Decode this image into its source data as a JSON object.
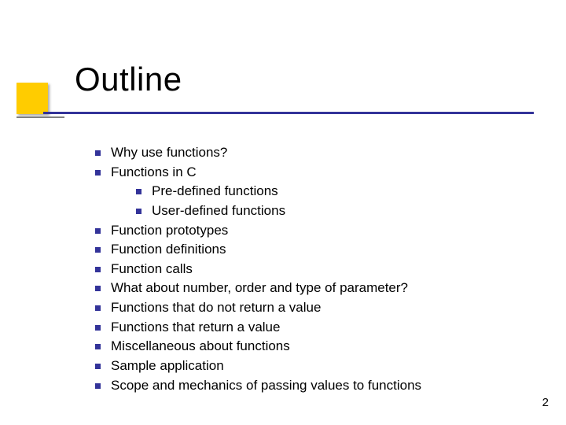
{
  "title": "Outline",
  "bullets": [
    {
      "text": "Why use functions?"
    },
    {
      "text": "Functions in C",
      "children": [
        {
          "text": "Pre-defined functions"
        },
        {
          "text": "User-defined functions"
        }
      ]
    },
    {
      "text": "Function prototypes"
    },
    {
      "text": "Function definitions"
    },
    {
      "text": "Function calls"
    },
    {
      "text": "What about number, order and type of parameter?"
    },
    {
      "text": "Functions that do not return a value"
    },
    {
      "text": "Functions that return a value"
    },
    {
      "text": "Miscellaneous about functions"
    },
    {
      "text": "Sample application"
    },
    {
      "text": "Scope and mechanics of passing values to functions"
    }
  ],
  "page_number": "2",
  "colors": {
    "accent": "#ffcc00",
    "rule": "#333399",
    "bullet": "#333399"
  }
}
